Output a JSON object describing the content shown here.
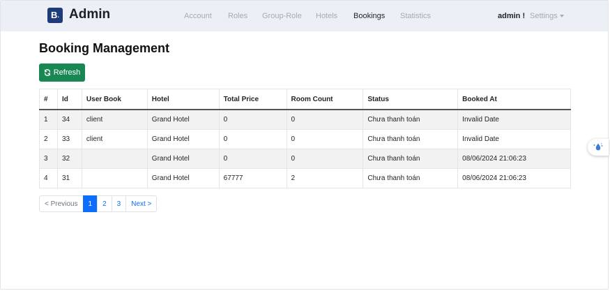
{
  "brand": {
    "logo_text": "B",
    "name": "Admin"
  },
  "nav": {
    "links": [
      {
        "label": "Account"
      },
      {
        "label": "Roles"
      },
      {
        "label": "Group-Role"
      },
      {
        "label": "Hotels"
      },
      {
        "label": "Bookings"
      },
      {
        "label": "Statistics"
      }
    ],
    "active": "Bookings",
    "user": "admin !",
    "settings": "Settings"
  },
  "page": {
    "title": "Booking Management",
    "refresh_label": "Refresh"
  },
  "table": {
    "headers": [
      "#",
      "Id",
      "User Book",
      "Hotel",
      "Total Price",
      "Room Count",
      "Status",
      "Booked At"
    ],
    "rows": [
      [
        "1",
        "34",
        "client",
        "Grand Hotel",
        "0",
        "0",
        "Chưa thanh toán",
        "Invalid Date"
      ],
      [
        "2",
        "33",
        "client",
        "Grand Hotel",
        "0",
        "0",
        "Chưa thanh toán",
        "Invalid Date"
      ],
      [
        "3",
        "32",
        "",
        "Grand Hotel",
        "0",
        "0",
        "Chưa thanh toán",
        "08/06/2024 21:06:23"
      ],
      [
        "4",
        "31",
        "",
        "Grand Hotel",
        "67777",
        "2",
        "Chưa thanh toán",
        "08/06/2024 21:06:23"
      ]
    ]
  },
  "pagination": {
    "prev": "< Previous",
    "pages": [
      "1",
      "2",
      "3"
    ],
    "active_page": "1",
    "next": "Next >"
  },
  "colors": {
    "navbar_bg": "#edeff7",
    "brand_logo": "#1d3d7a",
    "refresh_button": "#198754",
    "page_active": "#0d6efd"
  },
  "icons": {
    "refresh": "refresh-icon",
    "caret": "chevron-down-icon",
    "widget": "water-drop-icon"
  }
}
